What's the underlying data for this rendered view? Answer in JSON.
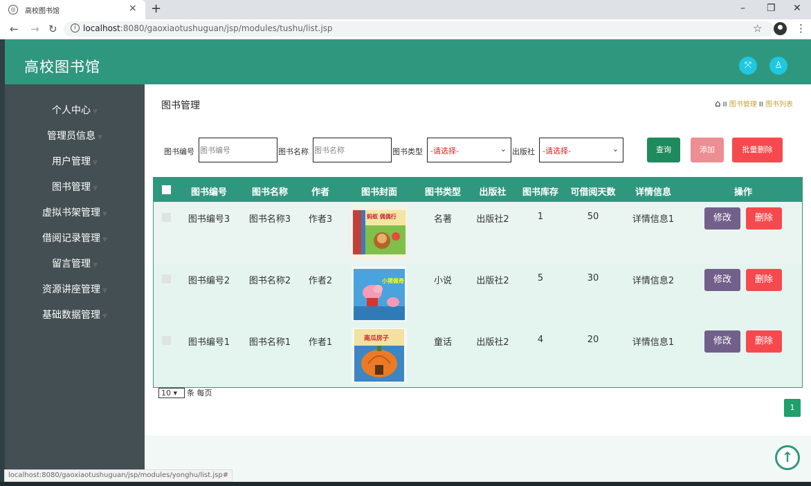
{
  "browser": {
    "tab_title": "高校图书馆",
    "tab_close": "×",
    "new_tab": "+",
    "url_host": "localhost",
    "url_rest": ":8080/gaoxiaotushuguan/jsp/modules/tushu/list.jsp",
    "status_url": "localhost:8080/gaoxiaotushuguan/jsp/modules/yonghu/list.jsp#"
  },
  "app": {
    "title": "高校图书馆"
  },
  "sidebar": {
    "items": [
      {
        "label": "个人中心"
      },
      {
        "label": "管理员信息"
      },
      {
        "label": "用户管理"
      },
      {
        "label": "图书管理"
      },
      {
        "label": "虚拟书架管理"
      },
      {
        "label": "借阅记录管理"
      },
      {
        "label": "留言管理"
      },
      {
        "label": "资源讲座管理"
      },
      {
        "label": "基础数据管理"
      }
    ]
  },
  "main": {
    "title": "图书管理",
    "breadcrumb": {
      "sep": "II",
      "level1": "图书管理",
      "level2": "图书列表"
    }
  },
  "filters": {
    "code_label": "图书编号",
    "code_placeholder": "图书编号",
    "name_label": "图书名称",
    "name_placeholder": "图书名称",
    "type_label": "图书类型",
    "type_value": "-请选择-",
    "publisher_label": "出版社",
    "publisher_value": "-请选择-",
    "search_button": "查询",
    "add_button": "添加",
    "batch_delete_button": "批量删除"
  },
  "table": {
    "headers": [
      "图书编号",
      "图书名称",
      "作者",
      "图书封面",
      "图书类型",
      "出版社",
      "图书库存",
      "可借阅天数",
      "详情信息",
      "操作"
    ],
    "edit_label": "修改",
    "delete_label": "删除",
    "rows": [
      {
        "code": "图书编号3",
        "name": "图书名称3",
        "author": "作者3",
        "cover_text": "蚂蚁 偶偶行",
        "type": "名著",
        "publisher": "出版社2",
        "stock": "1",
        "days": "50",
        "detail": "详情信息1"
      },
      {
        "code": "图书编号2",
        "name": "图书名称2",
        "author": "作者2",
        "cover_text": "小猪佩奇",
        "type": "小说",
        "publisher": "出版社2",
        "stock": "5",
        "days": "30",
        "detail": "详情信息2"
      },
      {
        "code": "图书编号1",
        "name": "图书名称1",
        "author": "作者1",
        "cover_text": "南瓜房子",
        "type": "童话",
        "publisher": "出版社2",
        "stock": "4",
        "days": "20",
        "detail": "详情信息1"
      }
    ]
  },
  "pagination": {
    "page_size": "10",
    "page_size_suffix": "条 每页",
    "current_page": "1"
  },
  "colors": {
    "header": "#30977f",
    "sidebar": "#434f52",
    "edit": "#72608a",
    "delete": "#f5494d"
  }
}
